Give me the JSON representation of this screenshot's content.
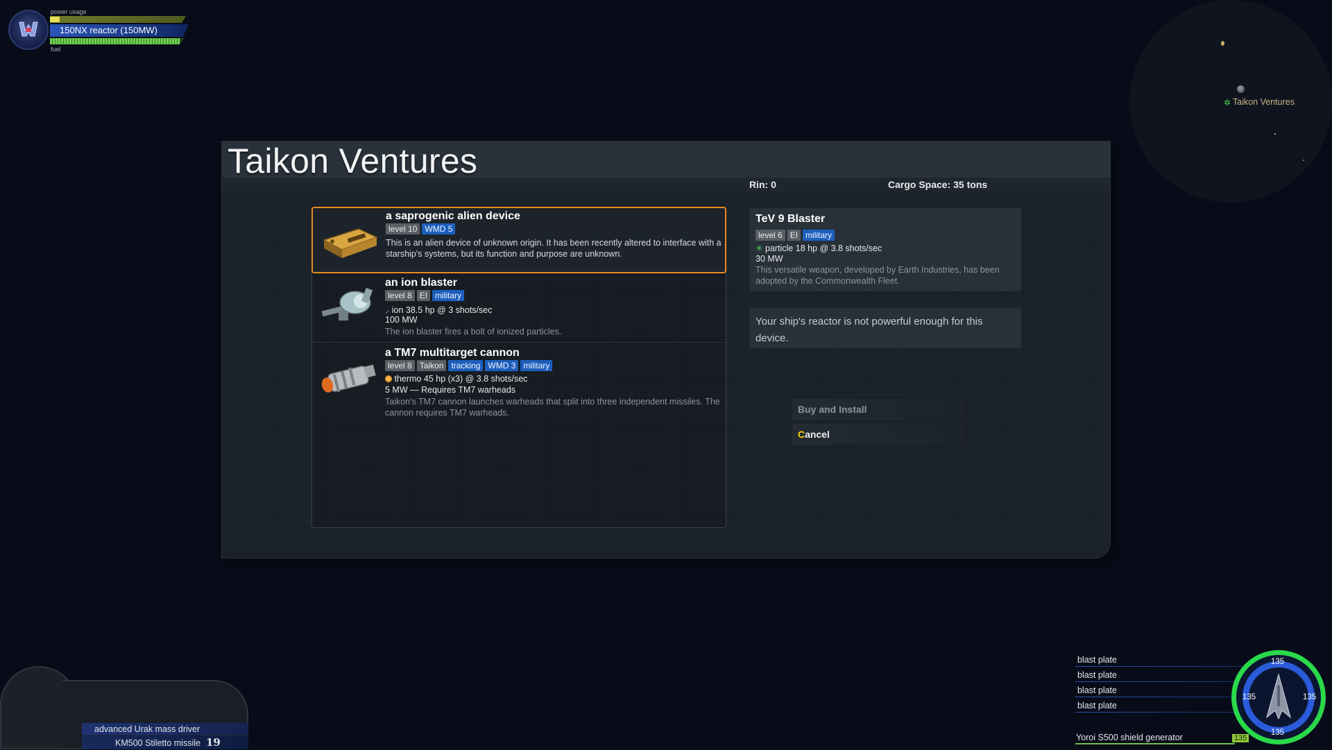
{
  "hud": {
    "power_label": "power usage",
    "reactor_name": "150NX reactor (150MW)",
    "fuel_label": "fuel",
    "power_usage_fraction": 0.07,
    "fuel_fraction": 0.97
  },
  "radar": {
    "station_label": "Taikon Ventures"
  },
  "dock": {
    "title": "Taikon Ventures",
    "rin": "Rin: 0",
    "cargo": "Cargo Space:  35 tons",
    "items": [
      {
        "title": "a saprogenic alien device",
        "tags": [
          {
            "text": "level 10",
            "color": "gray"
          },
          {
            "text": "WMD 5",
            "color": "blue"
          }
        ],
        "description": "This is an alien device of unknown origin. It has been recently altered to interface with a starship's systems, but its function and purpose are unknown.",
        "selected": true
      },
      {
        "title": "an ion blaster",
        "tags": [
          {
            "text": "level 8",
            "color": "gray"
          },
          {
            "text": "EI",
            "color": "gray"
          },
          {
            "text": "military",
            "color": "blue"
          }
        ],
        "stat": "ion 38.5 hp @ 3 shots/sec",
        "power": "100 MW",
        "description": "The ion blaster fires a bolt of ionized particles."
      },
      {
        "title": "a TM7 multitarget cannon",
        "tags": [
          {
            "text": "level 8",
            "color": "gray"
          },
          {
            "text": "Taikon",
            "color": "gray"
          },
          {
            "text": "tracking",
            "color": "blue"
          },
          {
            "text": "WMD 3",
            "color": "blue"
          },
          {
            "text": "military",
            "color": "blue"
          }
        ],
        "stat": "thermo 45 hp (x3) @ 3.8 shots/sec",
        "power": "5 MW — Requires TM7 warheads",
        "description": "Taikon's TM7 cannon launches warheads that split into three independent missiles. The cannon requires TM7 warheads."
      }
    ],
    "detail": {
      "title": "TeV 9 Blaster",
      "tags": [
        {
          "text": "level 6",
          "color": "gray"
        },
        {
          "text": "EI",
          "color": "gray"
        },
        {
          "text": "military",
          "color": "blue"
        }
      ],
      "stat": "particle 18 hp @ 3.8 shots/sec",
      "power": "30 MW",
      "description": "This versatile weapon, developed by Earth Industries, has been adopted by the Commonwealth Fleet."
    },
    "warning": "Your ship's reactor is not powerful enough for this device.",
    "actions": {
      "buy": "Buy and Install",
      "cancel_hotkey": "C",
      "cancel_rest": "ancel"
    }
  },
  "weapons": {
    "primary": "advanced Urak mass driver",
    "secondary": "KM500 Stiletto missile",
    "missile_count": "19"
  },
  "armor": {
    "segments": [
      "blast plate",
      "blast plate",
      "blast plate",
      "blast plate"
    ],
    "shield": "Yoroi S500 shield generator",
    "shield_value": "135",
    "values": {
      "top": "135",
      "left": "135",
      "right": "135",
      "bottom": "135"
    }
  },
  "colors": {
    "selection": "#e88a20",
    "tag_blue": "#1c5ebd",
    "tag_gray": "#5a5f66",
    "hotkey": "#ffd400",
    "shield_ring": "#29d94a"
  }
}
